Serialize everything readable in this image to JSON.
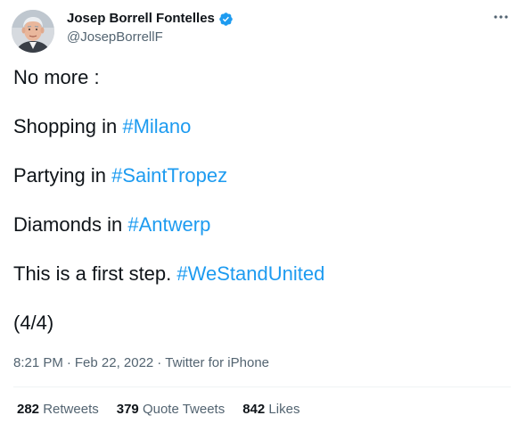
{
  "author": {
    "display_name": "Josep Borrell Fontelles",
    "handle": "@JosepBorrellF",
    "verified": true
  },
  "tweet": {
    "lines": [
      {
        "text": "No more :",
        "hashtag": ""
      },
      {
        "text": "Shopping in ",
        "hashtag": "#Milano"
      },
      {
        "text": "Partying in ",
        "hashtag": "#SaintTropez"
      },
      {
        "text": "Diamonds in ",
        "hashtag": "#Antwerp"
      },
      {
        "text": "This is a first step. ",
        "hashtag": "#WeStandUnited"
      },
      {
        "text": "(4/4)",
        "hashtag": ""
      }
    ]
  },
  "meta": {
    "time": "8:21 PM",
    "separator": "·",
    "date": "Feb 22, 2022",
    "source": "Twitter for iPhone"
  },
  "stats": {
    "retweets": {
      "count": "282",
      "label": "Retweets"
    },
    "quotes": {
      "count": "379",
      "label": "Quote Tweets"
    },
    "likes": {
      "count": "842",
      "label": "Likes"
    }
  },
  "colors": {
    "link": "#1d9bf0",
    "text": "#0f1419",
    "secondary": "#536471",
    "divider": "#eff3f4"
  },
  "icons": {
    "verified": "verified-badge-icon",
    "more": "more-horizontal-icon"
  }
}
